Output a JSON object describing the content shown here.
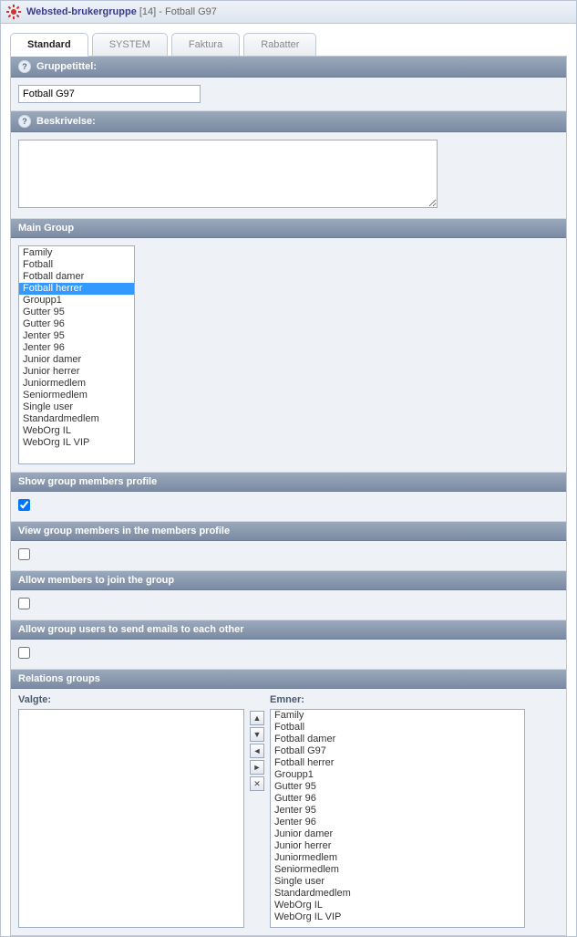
{
  "header": {
    "title_prefix": "Websted-brukergruppe",
    "id": "[14]",
    "separator": " - ",
    "title_suffix": "Fotball G97"
  },
  "tabs": [
    {
      "label": "Standard",
      "active": true
    },
    {
      "label": "SYSTEM",
      "active": false
    },
    {
      "label": "Faktura",
      "active": false
    },
    {
      "label": "Rabatter",
      "active": false
    }
  ],
  "sections": {
    "gruppetittel": {
      "label": "Gruppetittel:",
      "value": "Fotball G97"
    },
    "beskrivelse": {
      "label": "Beskrivelse:",
      "value": ""
    },
    "main_group": {
      "label": "Main Group",
      "selected": "Fotball herrer",
      "options": [
        "Family",
        "Fotball",
        "Fotball damer",
        "Fotball herrer",
        "Groupp1",
        "Gutter 95",
        "Gutter 96",
        "Jenter 95",
        "Jenter 96",
        "Junior damer",
        "Junior herrer",
        "Juniormedlem",
        "Seniormedlem",
        "Single user",
        "Standardmedlem",
        "WebOrg IL",
        "WebOrg IL VIP"
      ]
    },
    "show_profile": {
      "label": "Show group members profile",
      "checked": true
    },
    "view_members": {
      "label": "View group members in the members profile",
      "checked": false
    },
    "allow_join": {
      "label": "Allow members to join the group",
      "checked": false
    },
    "allow_emails": {
      "label": "Allow group users to send emails to each other",
      "checked": false
    },
    "relations": {
      "label": "Relations groups",
      "valgte_label": "Valgte:",
      "emner_label": "Emner:",
      "valgte": [],
      "emner": [
        "Family",
        "Fotball",
        "Fotball damer",
        "Fotball G97",
        "Fotball herrer",
        "Groupp1",
        "Gutter 95",
        "Gutter 96",
        "Jenter 95",
        "Jenter 96",
        "Junior damer",
        "Junior herrer",
        "Juniormedlem",
        "Seniormedlem",
        "Single user",
        "Standardmedlem",
        "WebOrg IL",
        "WebOrg IL VIP"
      ]
    }
  },
  "move_buttons": {
    "up": "▲",
    "down": "▼",
    "left": "◄",
    "right": "►",
    "remove": "✕"
  }
}
